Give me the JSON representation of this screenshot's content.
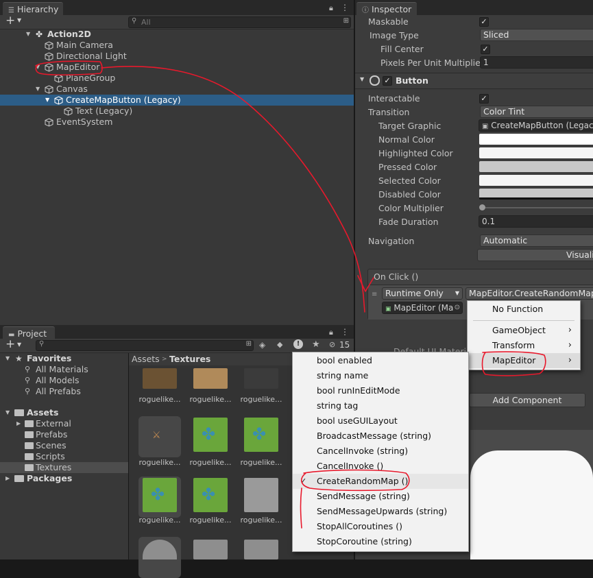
{
  "hierarchy": {
    "tab_label": "Hierarchy",
    "add_label": "+",
    "search_placeholder": "All",
    "items": [
      {
        "label": "Action2D"
      },
      {
        "label": "Main Camera"
      },
      {
        "label": "Directional Light"
      },
      {
        "label": "MapEditor"
      },
      {
        "label": "PlaneGroup"
      },
      {
        "label": "Canvas"
      },
      {
        "label": "CreateMapButton (Legacy)"
      },
      {
        "label": "Text (Legacy)"
      },
      {
        "label": "EventSystem"
      }
    ]
  },
  "inspector": {
    "tab_label": "Inspector",
    "maskable_label": "Maskable",
    "image_type_label": "Image Type",
    "image_type_value": "Sliced",
    "fill_center_label": "Fill Center",
    "ppu_label": "Pixels Per Unit Multiplier",
    "ppu_value": "1",
    "button_header": "Button",
    "interactable_label": "Interactable",
    "transition_label": "Transition",
    "transition_value": "Color Tint",
    "target_graphic_label": "Target Graphic",
    "target_graphic_value": "CreateMapButton (Legacy)",
    "normal_color_label": "Normal Color",
    "highlighted_color_label": "Highlighted Color",
    "pressed_color_label": "Pressed Color",
    "selected_color_label": "Selected Color",
    "disabled_color_label": "Disabled Color",
    "color_multiplier_label": "Color Multiplier",
    "color_multiplier_value": 1,
    "fade_duration_label": "Fade Duration",
    "fade_duration_value": "0.1",
    "navigation_label": "Navigation",
    "navigation_value": "Automatic",
    "visualize_label": "Visualize",
    "onclick_header": "On Click ()",
    "runtime_value": "Runtime Only",
    "function_value": "MapEditor.CreateRandomMap",
    "object_value": "MapEditor (Ma",
    "default_material_label": "Default UI Materi",
    "add_component_label": "Add Component"
  },
  "project": {
    "tab_label": "Project",
    "add_label": "+",
    "hidden_count": "15",
    "favorites_label": "Favorites",
    "favorites": [
      "All Materials",
      "All Models",
      "All Prefabs"
    ],
    "assets_label": "Assets",
    "assets": [
      "External",
      "Prefabs",
      "Scenes",
      "Scripts",
      "Textures"
    ],
    "packages_label": "Packages",
    "breadcrumb_root": "Assets",
    "breadcrumb_current": "Textures",
    "thumb_label": "roguelike..."
  },
  "function_menu": {
    "items": [
      "No Function",
      "GameObject",
      "Transform",
      "MapEditor"
    ]
  },
  "method_menu": {
    "items": [
      "bool enabled",
      "string name",
      "bool runInEditMode",
      "string tag",
      "bool useGUILayout",
      "BroadcastMessage (string)",
      "CancelInvoke (string)",
      "CancelInvoke ()",
      "CreateRandomMap ()",
      "SendMessage (string)",
      "SendMessageUpwards (string)",
      "StopAllCoroutines ()",
      "StopCoroutine (string)"
    ],
    "checked": "CreateRandomMap ()"
  },
  "colors": {
    "selection": "#2c5d87",
    "annotation": "#e8192c",
    "panel": "#383838"
  }
}
